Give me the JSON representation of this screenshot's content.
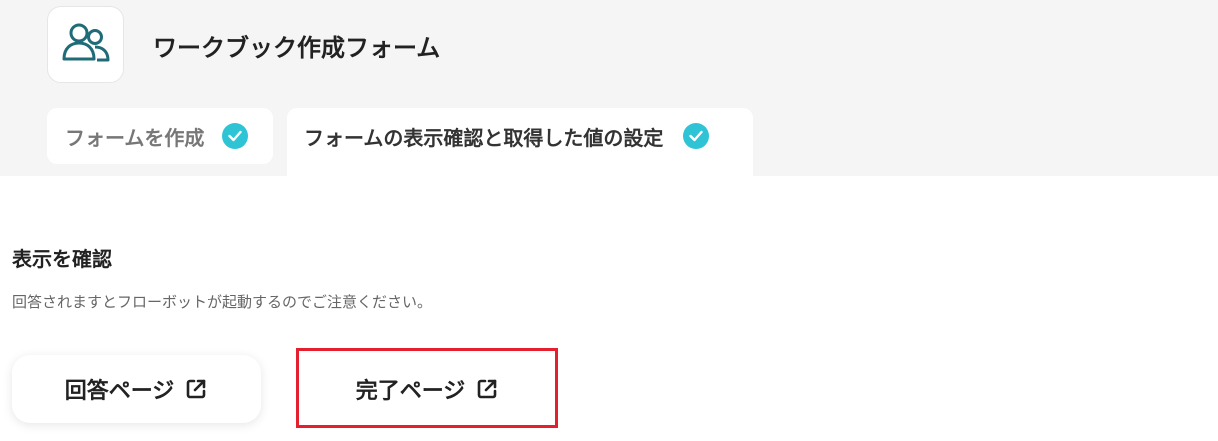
{
  "app": {
    "title": "ワークブック作成フォーム",
    "icon": "users-icon"
  },
  "tabs": [
    {
      "label": "フォームを作成",
      "status": "completed",
      "icon": "check-circle-icon"
    },
    {
      "label": "フォームの表示確認と取得した値の設定",
      "status": "completed",
      "icon": "check-circle-icon",
      "active": true
    }
  ],
  "section": {
    "title": "表示を確認",
    "note": "回答されますとフローボットが起動するのでご注意ください。"
  },
  "buttons": {
    "answer_page": "回答ページ",
    "complete_page": "完了ページ",
    "icon": "external-link-icon"
  },
  "colors": {
    "check": "#2ec4d6",
    "highlight": "#e5202e",
    "header_bg": "#f5f5f5",
    "icon_stroke": "#1f6b77"
  }
}
